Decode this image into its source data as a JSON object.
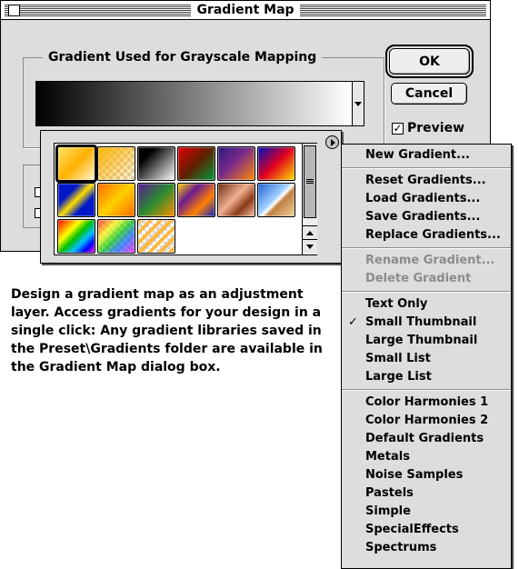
{
  "dialog": {
    "title": "Gradient Map",
    "group_label": "Gradient Used for Grayscale Mapping",
    "ok_label": "OK",
    "cancel_label": "Cancel",
    "preview_label": "Preview",
    "preview_checked": true
  },
  "swatches": [
    {
      "name": "foreground-to-background",
      "css": "linear-gradient(135deg,#ffe56a 0%,#ffb000 50%,#fff5cc 100%)"
    },
    {
      "name": "foreground-to-transparent",
      "css": "linear-gradient(135deg,#ffb400 0%,rgba(255,200,80,0.2) 100%),repeating-conic-gradient(#ccc 0% 25%, #fff 0% 50%) 0 0/8px 8px"
    },
    {
      "name": "black-white",
      "css": "linear-gradient(135deg,#000 0%,#000 25%,#ffffff 100%)"
    },
    {
      "name": "red-green",
      "css": "linear-gradient(135deg,#e00000 0%,#602000 50%,#009a3c 100%)"
    },
    {
      "name": "violet-orange",
      "css": "linear-gradient(135deg,#2a1a80 0%,#7a2a8a 45%,#ff8a00 100%)"
    },
    {
      "name": "blue-red-yellow",
      "css": "linear-gradient(135deg,#0010c0 0%,#e00020 50%,#ffe000 100%)"
    },
    {
      "name": "blue-yellow-blue",
      "css": "linear-gradient(135deg,#0018c8 0%,#0018c8 30%,#ffe000 50%,#0018c8 70%,#0018c8 100%)"
    },
    {
      "name": "orange-yellow-orange",
      "css": "linear-gradient(135deg,#ff6a00 0%,#ffd000 50%,#ff6a00 100%)"
    },
    {
      "name": "violet-green-orange",
      "css": "linear-gradient(135deg,#5a1a90 0%,#2a8a30 50%,#ff9000 100%)"
    },
    {
      "name": "yellow-violet-orange-blue",
      "css": "linear-gradient(135deg,#ffd000 0%,#6a1a90 33%,#ff8000 66%,#1020c0 100%)"
    },
    {
      "name": "copper",
      "css": "linear-gradient(135deg,#6a2a10 0%,#f0b090 45%,#8a3a18 70%,#f5c0a0 100%)"
    },
    {
      "name": "chrome",
      "css": "linear-gradient(135deg,#2060d0 0%,#a0d0ff 45%,#ffffff 52%,#c08040 60%,#f0d0a0 100%)"
    },
    {
      "name": "spectrum",
      "css": "linear-gradient(135deg,#ff0000 0%,#ff8000 17%,#ffff00 33%,#00c000 50%,#00c0ff 67%,#0000ff 83%,#ff00ff 100%)"
    },
    {
      "name": "transparent-rainbow",
      "css": "linear-gradient(135deg,rgba(255,0,0,0.7) 0%,rgba(255,255,0,0.7) 30%,rgba(0,200,0,0.7) 50%,rgba(0,100,255,0.7) 70%,rgba(255,0,255,0.7) 100%),repeating-conic-gradient(#ccc 0% 25%, #fff 0% 50%) 0 0/8px 8px"
    },
    {
      "name": "transparent-stripes",
      "css": "repeating-linear-gradient(135deg,#ffb840 0 4px,rgba(255,255,255,0.2) 4px 8px),repeating-conic-gradient(#ccc 0% 25%, #fff 0% 50%) 0 0/8px 8px"
    }
  ],
  "menu": {
    "groups": [
      {
        "items": [
          {
            "label": "New Gradient...",
            "enabled": true
          }
        ]
      },
      {
        "items": [
          {
            "label": "Reset Gradients...",
            "enabled": true
          },
          {
            "label": "Load Gradients...",
            "enabled": true
          },
          {
            "label": "Save Gradients...",
            "enabled": true
          },
          {
            "label": "Replace Gradients...",
            "enabled": true
          }
        ]
      },
      {
        "items": [
          {
            "label": "Rename Gradient...",
            "enabled": false
          },
          {
            "label": "Delete Gradient",
            "enabled": false
          }
        ]
      },
      {
        "items": [
          {
            "label": "Text Only",
            "enabled": true
          },
          {
            "label": "Small Thumbnail",
            "enabled": true,
            "checked": true
          },
          {
            "label": "Large Thumbnail",
            "enabled": true
          },
          {
            "label": "Small List",
            "enabled": true
          },
          {
            "label": "Large List",
            "enabled": true
          }
        ]
      },
      {
        "items": [
          {
            "label": "Color Harmonies 1",
            "enabled": true
          },
          {
            "label": "Color Harmonies 2",
            "enabled": true
          },
          {
            "label": "Default Gradients",
            "enabled": true
          },
          {
            "label": "Metals",
            "enabled": true
          },
          {
            "label": "Noise Samples",
            "enabled": true
          },
          {
            "label": "Pastels",
            "enabled": true
          },
          {
            "label": "Simple",
            "enabled": true
          },
          {
            "label": "SpecialEffects",
            "enabled": true
          },
          {
            "label": "Spectrums",
            "enabled": true
          }
        ]
      }
    ]
  },
  "caption": "Design a gradient map as an adjustment layer. Access gradients for your design in a single click: Any gradient libraries saved in the Preset\\Gradients folder are available in the Gradient Map dialog box."
}
